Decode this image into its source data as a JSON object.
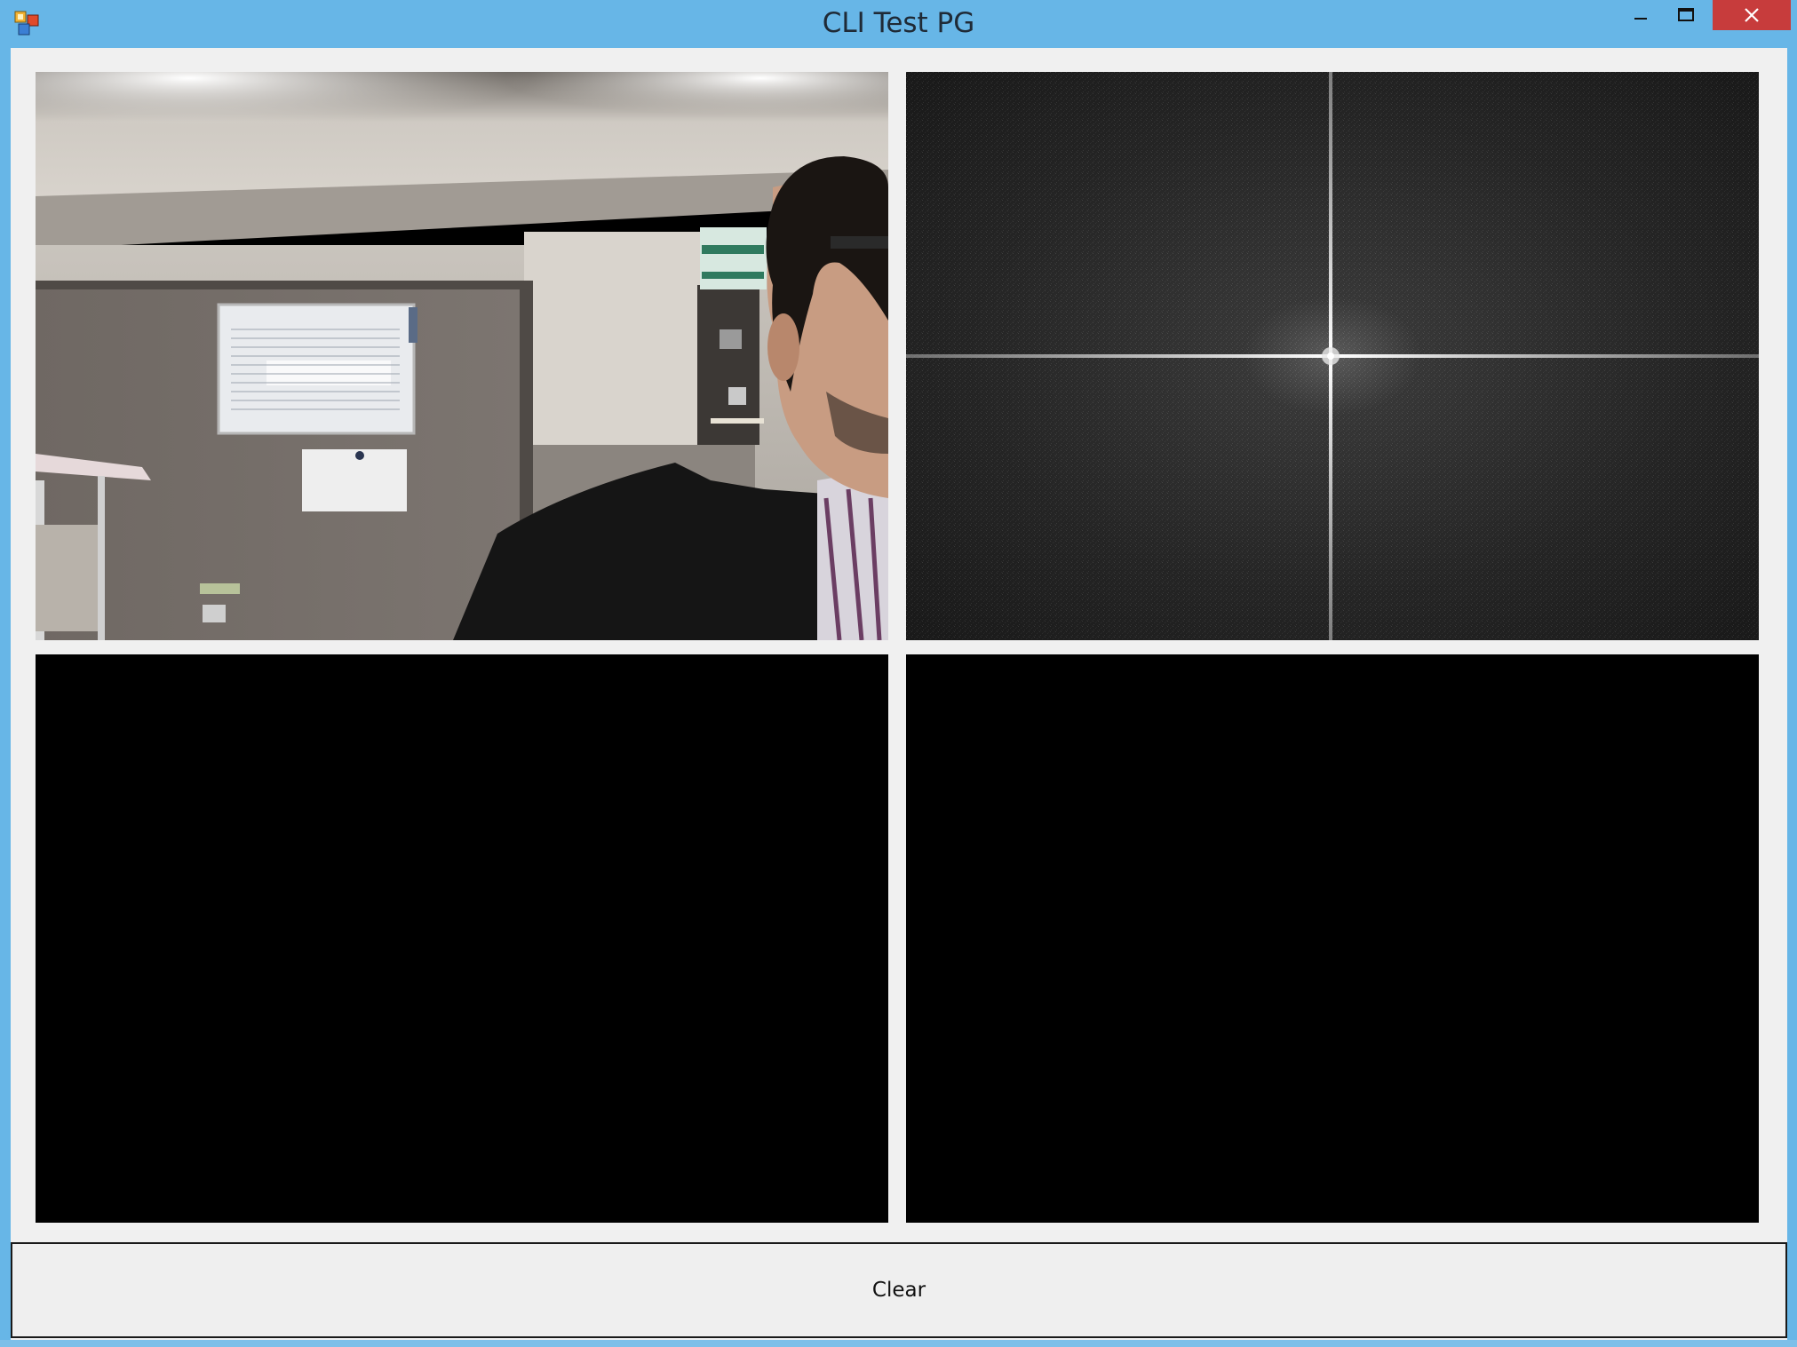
{
  "window": {
    "title": "CLI Test PG",
    "accent_color": "#67b6e7",
    "close_color": "#c73c3c"
  },
  "titlebar": {
    "icon": "app-icon",
    "minimize_icon": "minimize-icon",
    "maximize_icon": "maximize-icon",
    "close_icon": "close-icon"
  },
  "panels": [
    {
      "name": "camera-view",
      "content": "webcam image of office room with person"
    },
    {
      "name": "fft-spectrum-view",
      "content": "frequency spectrum image"
    },
    {
      "name": "output-view-1",
      "content": "black"
    },
    {
      "name": "output-view-2",
      "content": "black"
    }
  ],
  "controls": {
    "clear_label": "Clear"
  }
}
